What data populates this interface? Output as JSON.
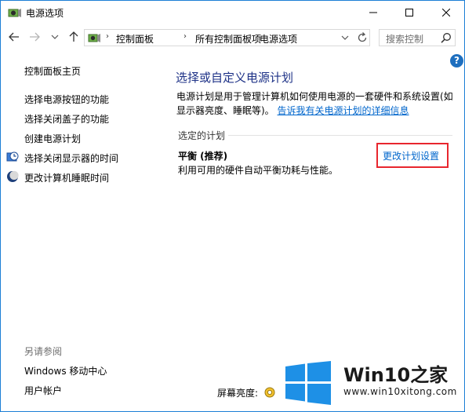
{
  "window": {
    "title": "电源选项"
  },
  "address": {
    "breadcrumbs": [
      "控制面板",
      "所有控制面板项",
      "电源选项"
    ],
    "search_placeholder": "搜索控制"
  },
  "help": {
    "label": "?"
  },
  "left_pane": {
    "home_link": "控制面板主页",
    "links": [
      "选择电源按钮的功能",
      "选择关闭盖子的功能",
      "创建电源计划",
      "选择关闭显示器的时间",
      "更改计算机睡眠时间"
    ],
    "see_also_label": "另请参阅",
    "see_also_links": [
      "Windows 移动中心",
      "用户帐户"
    ]
  },
  "main": {
    "title": "选择或自定义电源计划",
    "description": "电源计划是用于管理计算机如何使用电源的一套硬件和系统设置(如显示器亮度、睡眠等)。",
    "description_link": "告诉我有关电源计划的详细信息",
    "selected_section_label": "选定的计划",
    "plan": {
      "name": "平衡 (推荐)",
      "description": "利用可用的硬件自动平衡功耗与性能。",
      "change_link": "更改计划设置"
    },
    "highlight_color": "#e8262e"
  },
  "footer": {
    "brightness_label": "屏幕亮度:"
  },
  "watermark": {
    "title_prefix": "Win10",
    "title_suffix": "之家",
    "url": "www.win10xitong.com"
  },
  "colors": {
    "link": "#0066cc",
    "title": "#1e3287",
    "accent": "#1e6fbf"
  }
}
